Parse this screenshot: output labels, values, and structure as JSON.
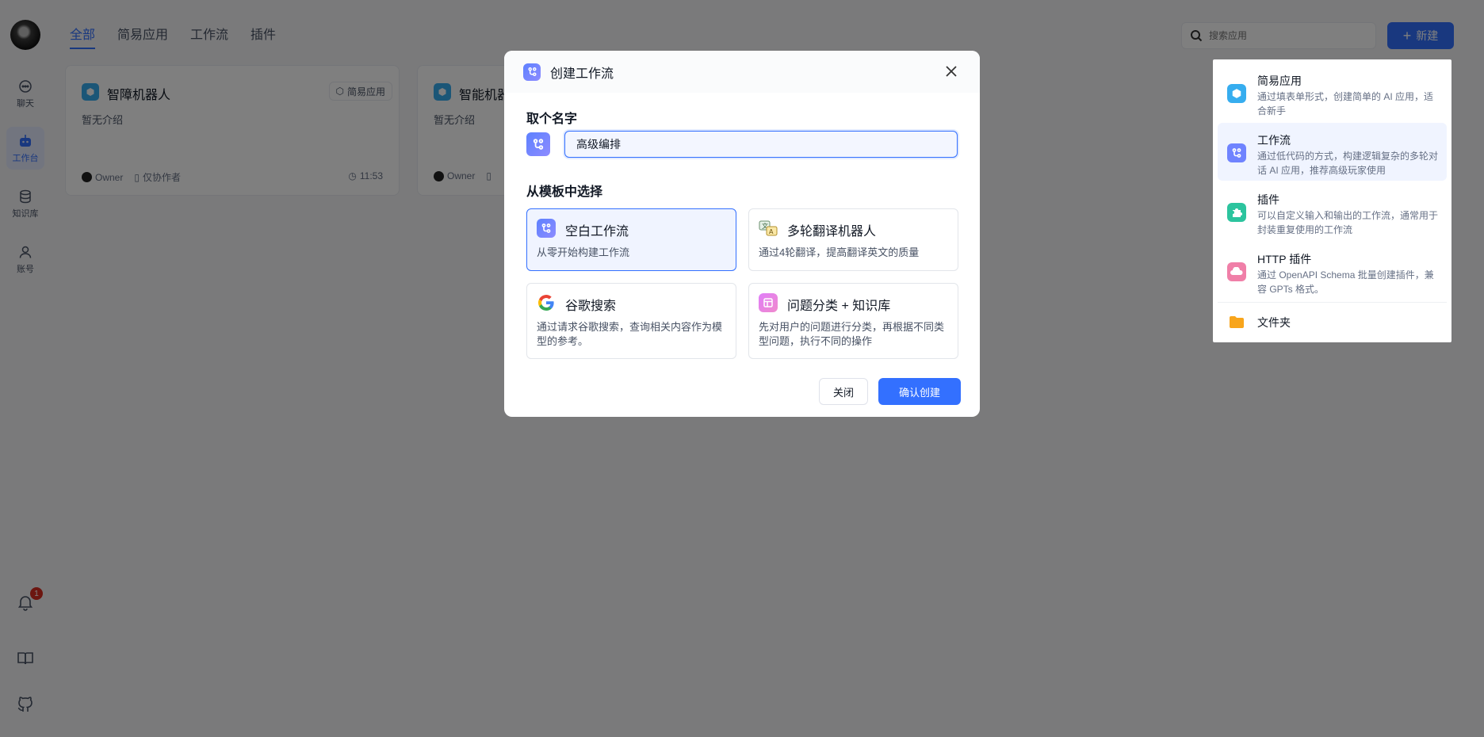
{
  "nav": {
    "items": [
      {
        "label": "聊天",
        "icon": "chat-icon"
      },
      {
        "label": "工作台",
        "icon": "robot-icon"
      },
      {
        "label": "知识库",
        "icon": "database-icon"
      },
      {
        "label": "账号",
        "icon": "user-icon"
      }
    ],
    "notification_count": "1"
  },
  "tabs": [
    "全部",
    "简易应用",
    "工作流",
    "插件"
  ],
  "search": {
    "placeholder": "搜索应用"
  },
  "new_button": "新建",
  "cards": [
    {
      "name": "智障机器人",
      "tag": "简易应用",
      "desc": "暂无介绍",
      "owner": "Owner",
      "permission": "仅协作者",
      "time": "11:53"
    },
    {
      "name": "智能机器",
      "desc": "暂无介绍",
      "owner": "Owner"
    }
  ],
  "menu": {
    "items": [
      {
        "title": "简易应用",
        "desc": "通过填表单形式，创建简单的 AI 应用，适合新手",
        "icon": "cube-icon",
        "color": "#36adef"
      },
      {
        "title": "工作流",
        "desc": "通过低代码的方式，构建逻辑复杂的多轮对话 AI 应用，推荐高级玩家使用",
        "icon": "workflow-icon",
        "color": "#6f83ff"
      },
      {
        "title": "插件",
        "desc": "可以自定义输入和输出的工作流，通常用于封装重复使用的工作流",
        "icon": "puzzle-icon",
        "color": "#2cc49e"
      },
      {
        "title": "HTTP 插件",
        "desc": "通过 OpenAPI Schema 批量创建插件，兼容 GPTs 格式。",
        "icon": "http-icon",
        "color": "#f07fa8"
      }
    ],
    "folder": "文件夹"
  },
  "modal": {
    "title": "创建工作流",
    "name_label": "取个名字",
    "name_value": "高级编排",
    "template_label": "从模板中选择",
    "templates": [
      {
        "title": "空白工作流",
        "desc": "从零开始构建工作流"
      },
      {
        "title": "多轮翻译机器人",
        "desc": "通过4轮翻译，提高翻译英文的质量"
      },
      {
        "title": "谷歌搜索",
        "desc": "通过请求谷歌搜索，查询相关内容作为模型的参考。"
      },
      {
        "title": "问题分类 + 知识库",
        "desc": "先对用户的问题进行分类，再根据不同类型问题，执行不同的操作"
      }
    ],
    "close_button": "关闭",
    "confirm_button": "确认创建"
  },
  "colors": {
    "accent": "#3370ff",
    "overlay": "rgba(0,0,0,0.5)"
  }
}
